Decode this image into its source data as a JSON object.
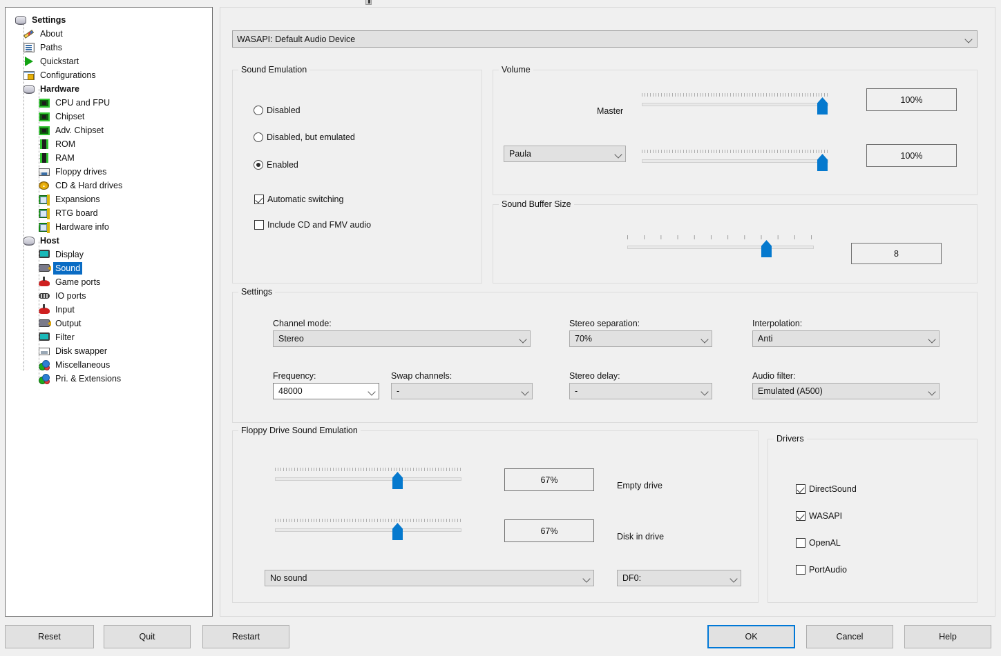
{
  "sidebar": {
    "items": [
      {
        "label": "Settings",
        "icon": "stack-icon",
        "level": 0,
        "bold": true,
        "selected": false
      },
      {
        "label": "About",
        "icon": "pencil-icon",
        "level": 1,
        "bold": false,
        "selected": false
      },
      {
        "label": "Paths",
        "icon": "paths-icon",
        "level": 1,
        "bold": false,
        "selected": false
      },
      {
        "label": "Quickstart",
        "icon": "play-icon",
        "level": 1,
        "bold": false,
        "selected": false
      },
      {
        "label": "Configurations",
        "icon": "config-icon",
        "level": 1,
        "bold": false,
        "selected": false
      },
      {
        "label": "Hardware",
        "icon": "stack-icon",
        "level": 1,
        "bold": true,
        "selected": false
      },
      {
        "label": "CPU and FPU",
        "icon": "chip-icon",
        "level": 2,
        "bold": false,
        "selected": false
      },
      {
        "label": "Chipset",
        "icon": "chip-icon",
        "level": 2,
        "bold": false,
        "selected": false
      },
      {
        "label": "Adv. Chipset",
        "icon": "chip-icon",
        "level": 2,
        "bold": false,
        "selected": false
      },
      {
        "label": "ROM",
        "icon": "rom-icon",
        "level": 2,
        "bold": false,
        "selected": false
      },
      {
        "label": "RAM",
        "icon": "rom-icon",
        "level": 2,
        "bold": false,
        "selected": false
      },
      {
        "label": "Floppy drives",
        "icon": "floppy-icon",
        "level": 2,
        "bold": false,
        "selected": false
      },
      {
        "label": "CD & Hard drives",
        "icon": "cd-icon",
        "level": 2,
        "bold": false,
        "selected": false
      },
      {
        "label": "Expansions",
        "icon": "expansion-icon",
        "level": 2,
        "bold": false,
        "selected": false
      },
      {
        "label": "RTG board",
        "icon": "expansion-icon",
        "level": 2,
        "bold": false,
        "selected": false
      },
      {
        "label": "Hardware info",
        "icon": "expansion-icon",
        "level": 2,
        "bold": false,
        "selected": false
      },
      {
        "label": "Host",
        "icon": "stack-icon",
        "level": 1,
        "bold": true,
        "selected": false
      },
      {
        "label": "Display",
        "icon": "monitor-icon",
        "level": 2,
        "bold": false,
        "selected": false
      },
      {
        "label": "Sound",
        "icon": "speaker-icon",
        "level": 2,
        "bold": false,
        "selected": true
      },
      {
        "label": "Game ports",
        "icon": "joystick-icon",
        "level": 2,
        "bold": false,
        "selected": false
      },
      {
        "label": "IO ports",
        "icon": "ioports-icon",
        "level": 2,
        "bold": false,
        "selected": false
      },
      {
        "label": "Input",
        "icon": "joystick-icon",
        "level": 2,
        "bold": false,
        "selected": false
      },
      {
        "label": "Output",
        "icon": "speaker-icon",
        "level": 2,
        "bold": false,
        "selected": false
      },
      {
        "label": "Filter",
        "icon": "monitor-icon",
        "level": 2,
        "bold": false,
        "selected": false
      },
      {
        "label": "Disk swapper",
        "icon": "diskswap-icon",
        "level": 2,
        "bold": false,
        "selected": false
      },
      {
        "label": "Miscellaneous",
        "icon": "spheres-icon",
        "level": 2,
        "bold": false,
        "selected": false
      },
      {
        "label": "Pri. & Extensions",
        "icon": "spheres-icon",
        "level": 2,
        "bold": false,
        "selected": false
      }
    ]
  },
  "audio_device": {
    "value": "WASAPI: Default Audio Device"
  },
  "sound_emulation": {
    "title": "Sound Emulation",
    "options": [
      {
        "label": "Disabled",
        "selected": false
      },
      {
        "label": "Disabled, but emulated",
        "selected": false
      },
      {
        "label": "Enabled",
        "selected": true
      }
    ],
    "checkboxes": [
      {
        "label": "Automatic switching",
        "checked": true
      },
      {
        "label": "Include CD and FMV audio",
        "checked": false
      }
    ]
  },
  "volume": {
    "title": "Volume",
    "master_label": "Master",
    "master_value": "100%",
    "master_percent": 100,
    "channel_select": "Paula",
    "channel_value": "100%",
    "channel_percent": 100
  },
  "buffer": {
    "title": "Sound Buffer Size",
    "value": "8",
    "percent": 73
  },
  "settings": {
    "title": "Settings",
    "channel_mode_label": "Channel mode:",
    "channel_mode_value": "Stereo",
    "frequency_label": "Frequency:",
    "frequency_value": "48000",
    "swap_channels_label": "Swap channels:",
    "swap_channels_value": "-",
    "stereo_separation_label": "Stereo separation:",
    "stereo_separation_value": "70%",
    "stereo_delay_label": "Stereo delay:",
    "stereo_delay_value": "-",
    "interpolation_label": "Interpolation:",
    "interpolation_value": "Anti",
    "audio_filter_label": "Audio filter:",
    "audio_filter_value": "Emulated (A500)"
  },
  "floppy": {
    "title": "Floppy Drive Sound Emulation",
    "empty_drive_label": "Empty drive",
    "empty_drive_value": "67%",
    "empty_drive_percent": 65,
    "disk_in_drive_label": "Disk in drive",
    "disk_in_drive_value": "67%",
    "disk_in_drive_percent": 65,
    "sound_select": "No sound",
    "drive_select": "DF0:"
  },
  "drivers": {
    "title": "Drivers",
    "items": [
      {
        "label": "DirectSound",
        "checked": true
      },
      {
        "label": "WASAPI",
        "checked": true
      },
      {
        "label": "OpenAL",
        "checked": false
      },
      {
        "label": "PortAudio",
        "checked": false
      }
    ]
  },
  "buttons": {
    "reset": "Reset",
    "quit": "Quit",
    "restart": "Restart",
    "ok": "OK",
    "cancel": "Cancel",
    "help": "Help"
  },
  "colors": {
    "accent": "#0579ce",
    "selection": "#0a6cc4",
    "focus": "#0078d7",
    "window_bg": "#f0f0f0"
  }
}
